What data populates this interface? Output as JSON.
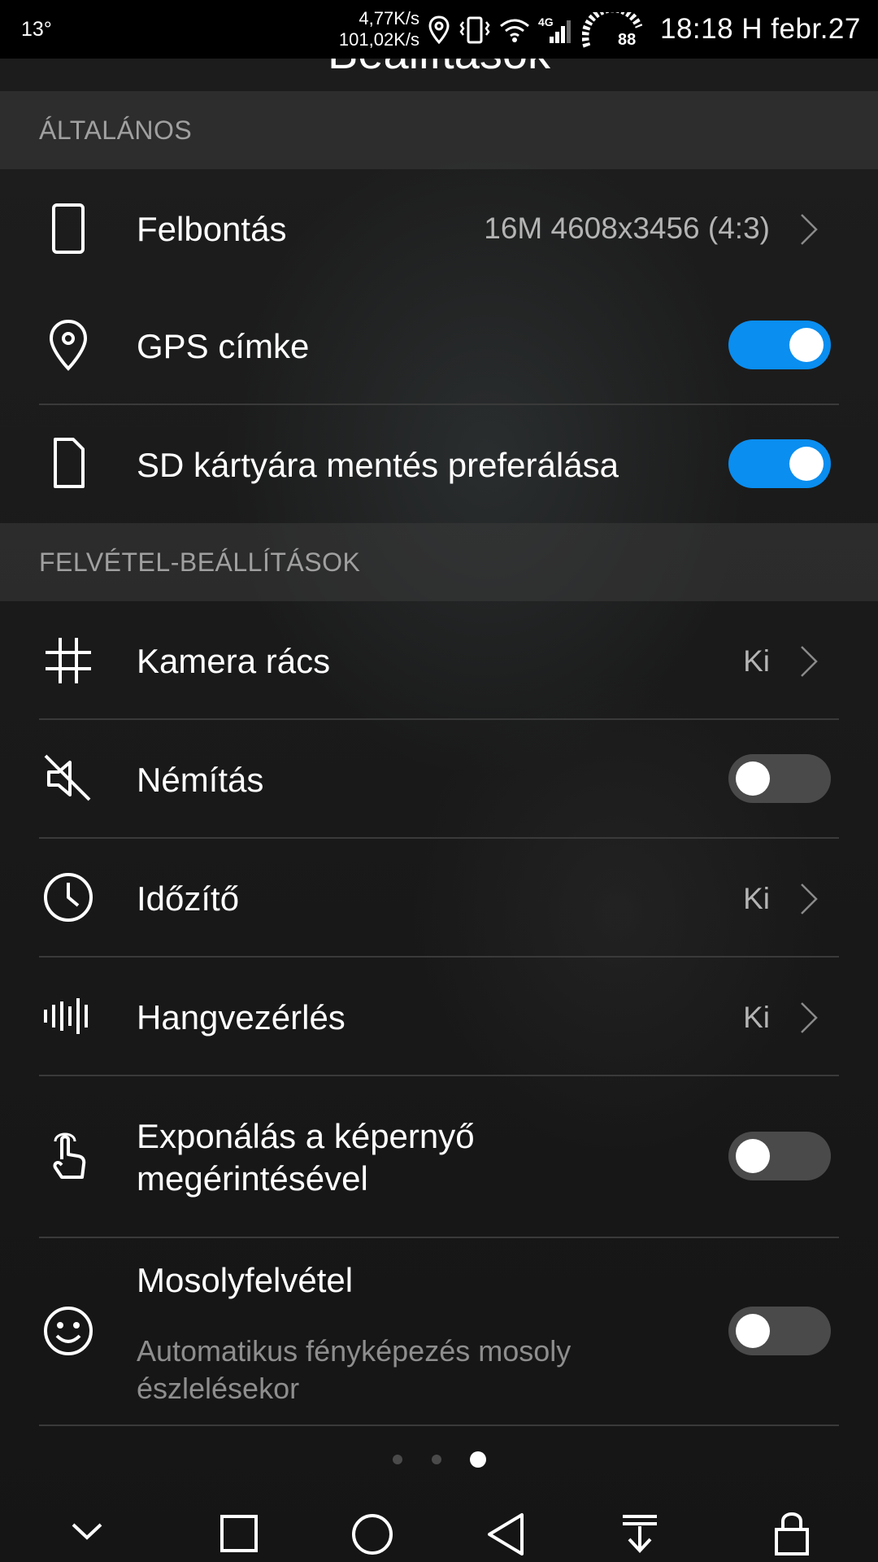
{
  "status_bar": {
    "temperature": "13°",
    "speed_up": "4,77K/s",
    "speed_down": "101,02K/s",
    "network_type": "4G",
    "gauge_value": "88",
    "time_date": "18:18 H febr.27"
  },
  "header": {
    "title": "Beállítások"
  },
  "sections": {
    "general": {
      "title": "ÁLTALÁNOS",
      "items": {
        "resolution": {
          "label": "Felbontás",
          "value": "16M 4608x3456 (4:3)"
        },
        "gps": {
          "label": "GPS címke",
          "toggle": "on"
        },
        "sd": {
          "label": "SD kártyára mentés preferálása",
          "toggle": "on"
        }
      }
    },
    "capture": {
      "title": "FELVÉTEL-BEÁLLÍTÁSOK",
      "items": {
        "grid": {
          "label": "Kamera rács",
          "value": "Ki"
        },
        "mute": {
          "label": "Némítás",
          "toggle": "off"
        },
        "timer": {
          "label": "Időzítő",
          "value": "Ki"
        },
        "voice": {
          "label": "Hangvezérlés",
          "value": "Ki"
        },
        "touch": {
          "label_line1": "Exponálás a képernyő",
          "label_line2": "megérintésével",
          "toggle": "off"
        },
        "smile": {
          "label": "Mosolyfelvétel",
          "sub_line1": "Automatikus fényképezés mosoly",
          "sub_line2": "észlelésekor",
          "toggle": "off"
        }
      }
    }
  },
  "page_indicator": {
    "count": 3,
    "active": 3
  },
  "colors": {
    "accent": "#0a8ef0",
    "background": "#1a1a1a",
    "secondary_text": "#b4b4b4"
  },
  "nav_bar": [
    "chevron-down-icon",
    "square-icon",
    "circle-home-icon",
    "triangle-back-icon",
    "download-icon",
    "lock-icon"
  ]
}
